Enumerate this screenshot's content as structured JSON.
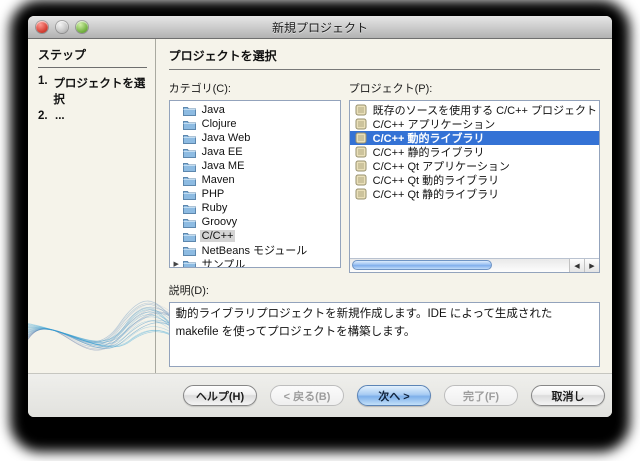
{
  "window": {
    "title": "新規プロジェクト"
  },
  "sidebar": {
    "header": "ステップ",
    "steps": [
      {
        "num": "1.",
        "label": "プロジェクトを選択"
      },
      {
        "num": "2.",
        "label": "..."
      }
    ]
  },
  "main": {
    "header": "プロジェクトを選択",
    "categories": {
      "label": "カテゴリ(C):",
      "items": [
        "Java",
        "Clojure",
        "Java Web",
        "Java EE",
        "Java ME",
        "Maven",
        "PHP",
        "Ruby",
        "Groovy",
        "C/C++",
        "NetBeans モジュール",
        "サンプル"
      ],
      "selected": "C/C++",
      "expandable": "サンプル"
    },
    "projects": {
      "label": "プロジェクト(P):",
      "items": [
        "既存のソースを使用する C/C++ プロジェクト",
        "C/C++ アプリケーション",
        "C/C++ 動的ライブラリ",
        "C/C++ 静的ライブラリ",
        "C/C++ Qt アプリケーション",
        "C/C++ Qt 動的ライブラリ",
        "C/C++ Qt 静的ライブラリ"
      ],
      "selected": "C/C++ 動的ライブラリ"
    },
    "description": {
      "label": "説明(D):",
      "text": "動的ライブラリプロジェクトを新規作成します。IDE によって生成された makefile を使ってプロジェクトを構築します。"
    }
  },
  "footer": {
    "buttons": [
      {
        "label": "ヘルプ(H)",
        "state": "enabled",
        "name": "help-button"
      },
      {
        "label": "< 戻る(B)",
        "state": "disabled",
        "name": "back-button"
      },
      {
        "label": "次へ >",
        "state": "default",
        "name": "next-button"
      },
      {
        "label": "完了(F)",
        "state": "disabled",
        "name": "finish-button"
      },
      {
        "label": "取消し",
        "state": "enabled",
        "name": "cancel-button"
      }
    ]
  },
  "colors": {
    "selection_blue": "#3472d5",
    "content_cream": "#f5f3ea",
    "list_border": "#93a3bc",
    "inactive_selection_gray": "#d4d4d4"
  }
}
